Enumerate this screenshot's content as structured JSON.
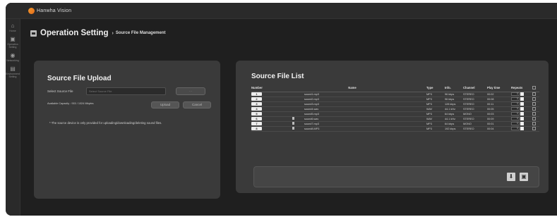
{
  "app": {
    "brand": "Hanwha Vision"
  },
  "sidebar": {
    "items": [
      {
        "icon": "home-icon",
        "label": "Home"
      },
      {
        "icon": "operation-setting-icon",
        "label": "Operation Setting"
      },
      {
        "icon": "networking-icon",
        "label": "Networking"
      },
      {
        "icon": "environment-setting-icon",
        "label": "Environment Setting"
      }
    ]
  },
  "header": {
    "title": "Operation Setting",
    "separator": "›",
    "breadcrumb": "Source File Management"
  },
  "upload": {
    "title": "Source File Upload",
    "select_label": "Select Source File",
    "select_placeholder": "Select Source File",
    "browse_label": "...",
    "capacity": "Available Capacity : 915 / 1024 Mbytes",
    "upload_label": "Upload",
    "cancel_label": "Cancel",
    "note": "* The source device is only provided for uploading/downloading/deleting sound files."
  },
  "list": {
    "title": "Source File List",
    "columns": [
      "Number",
      "Name",
      "Type",
      "Info.",
      "Channel",
      "Play time",
      "Repeats"
    ],
    "rows": [
      {
        "number": "1",
        "name": "sound1.mp3",
        "type": "MP3",
        "info": "96 kbps",
        "channel": "STEREO",
        "play_time": "00:02",
        "repeats": "1",
        "icon": false
      },
      {
        "number": "2",
        "name": "sound2.mp3",
        "type": "MP3",
        "info": "96 kbps",
        "channel": "STEREO",
        "play_time": "00:08",
        "repeats": "1",
        "icon": false
      },
      {
        "number": "3",
        "name": "sound3.mp3",
        "type": "MP3",
        "info": "128 kbps",
        "channel": "STEREO",
        "play_time": "00:11",
        "repeats": "1",
        "icon": false
      },
      {
        "number": "4",
        "name": "sound4.wav",
        "type": "WAV",
        "info": "44.1 kHz",
        "channel": "STEREO",
        "play_time": "00:05",
        "repeats": "1",
        "icon": false
      },
      {
        "number": "5",
        "name": "sound5.mp3",
        "type": "MP3",
        "info": "64 kbps",
        "channel": "MONO",
        "play_time": "00:03",
        "repeats": "1",
        "icon": false
      },
      {
        "number": "6",
        "name": "sound6.wav",
        "type": "WAV",
        "info": "44.1 kHz",
        "channel": "STEREO",
        "play_time": "00:09",
        "repeats": "1",
        "icon": true
      },
      {
        "number": "7",
        "name": "sound7.mp3",
        "type": "MP3",
        "info": "64 kbps",
        "channel": "MONO",
        "play_time": "00:01",
        "repeats": "1",
        "icon": true
      },
      {
        "number": "8",
        "name": "sound8.MP3",
        "type": "MP3",
        "info": "192 kbps",
        "channel": "STEREO",
        "play_time": "00:04",
        "repeats": "1",
        "icon": true
      }
    ]
  },
  "actions": {
    "download_icon": "download-icon",
    "delete_icon": "delete-icon"
  }
}
